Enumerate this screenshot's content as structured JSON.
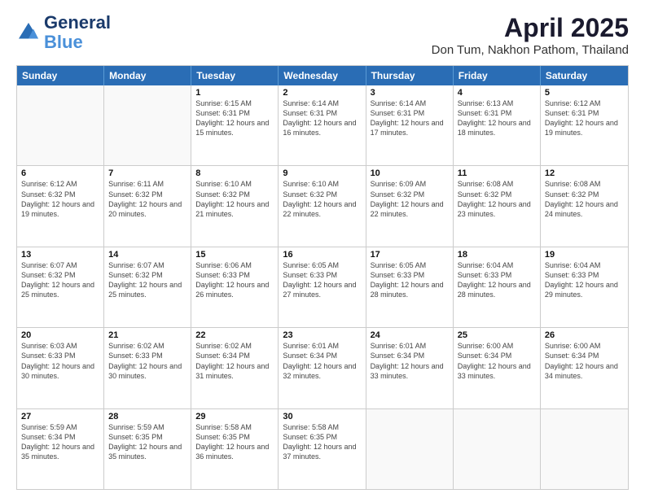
{
  "header": {
    "logo_line1": "General",
    "logo_line2": "Blue",
    "main_title": "April 2025",
    "sub_title": "Don Tum, Nakhon Pathom, Thailand"
  },
  "calendar": {
    "days": [
      "Sunday",
      "Monday",
      "Tuesday",
      "Wednesday",
      "Thursday",
      "Friday",
      "Saturday"
    ],
    "rows": [
      [
        {
          "day": "",
          "info": ""
        },
        {
          "day": "",
          "info": ""
        },
        {
          "day": "1",
          "info": "Sunrise: 6:15 AM\nSunset: 6:31 PM\nDaylight: 12 hours and 15 minutes."
        },
        {
          "day": "2",
          "info": "Sunrise: 6:14 AM\nSunset: 6:31 PM\nDaylight: 12 hours and 16 minutes."
        },
        {
          "day": "3",
          "info": "Sunrise: 6:14 AM\nSunset: 6:31 PM\nDaylight: 12 hours and 17 minutes."
        },
        {
          "day": "4",
          "info": "Sunrise: 6:13 AM\nSunset: 6:31 PM\nDaylight: 12 hours and 18 minutes."
        },
        {
          "day": "5",
          "info": "Sunrise: 6:12 AM\nSunset: 6:31 PM\nDaylight: 12 hours and 19 minutes."
        }
      ],
      [
        {
          "day": "6",
          "info": "Sunrise: 6:12 AM\nSunset: 6:32 PM\nDaylight: 12 hours and 19 minutes."
        },
        {
          "day": "7",
          "info": "Sunrise: 6:11 AM\nSunset: 6:32 PM\nDaylight: 12 hours and 20 minutes."
        },
        {
          "day": "8",
          "info": "Sunrise: 6:10 AM\nSunset: 6:32 PM\nDaylight: 12 hours and 21 minutes."
        },
        {
          "day": "9",
          "info": "Sunrise: 6:10 AM\nSunset: 6:32 PM\nDaylight: 12 hours and 22 minutes."
        },
        {
          "day": "10",
          "info": "Sunrise: 6:09 AM\nSunset: 6:32 PM\nDaylight: 12 hours and 22 minutes."
        },
        {
          "day": "11",
          "info": "Sunrise: 6:08 AM\nSunset: 6:32 PM\nDaylight: 12 hours and 23 minutes."
        },
        {
          "day": "12",
          "info": "Sunrise: 6:08 AM\nSunset: 6:32 PM\nDaylight: 12 hours and 24 minutes."
        }
      ],
      [
        {
          "day": "13",
          "info": "Sunrise: 6:07 AM\nSunset: 6:32 PM\nDaylight: 12 hours and 25 minutes."
        },
        {
          "day": "14",
          "info": "Sunrise: 6:07 AM\nSunset: 6:32 PM\nDaylight: 12 hours and 25 minutes."
        },
        {
          "day": "15",
          "info": "Sunrise: 6:06 AM\nSunset: 6:33 PM\nDaylight: 12 hours and 26 minutes."
        },
        {
          "day": "16",
          "info": "Sunrise: 6:05 AM\nSunset: 6:33 PM\nDaylight: 12 hours and 27 minutes."
        },
        {
          "day": "17",
          "info": "Sunrise: 6:05 AM\nSunset: 6:33 PM\nDaylight: 12 hours and 28 minutes."
        },
        {
          "day": "18",
          "info": "Sunrise: 6:04 AM\nSunset: 6:33 PM\nDaylight: 12 hours and 28 minutes."
        },
        {
          "day": "19",
          "info": "Sunrise: 6:04 AM\nSunset: 6:33 PM\nDaylight: 12 hours and 29 minutes."
        }
      ],
      [
        {
          "day": "20",
          "info": "Sunrise: 6:03 AM\nSunset: 6:33 PM\nDaylight: 12 hours and 30 minutes."
        },
        {
          "day": "21",
          "info": "Sunrise: 6:02 AM\nSunset: 6:33 PM\nDaylight: 12 hours and 30 minutes."
        },
        {
          "day": "22",
          "info": "Sunrise: 6:02 AM\nSunset: 6:34 PM\nDaylight: 12 hours and 31 minutes."
        },
        {
          "day": "23",
          "info": "Sunrise: 6:01 AM\nSunset: 6:34 PM\nDaylight: 12 hours and 32 minutes."
        },
        {
          "day": "24",
          "info": "Sunrise: 6:01 AM\nSunset: 6:34 PM\nDaylight: 12 hours and 33 minutes."
        },
        {
          "day": "25",
          "info": "Sunrise: 6:00 AM\nSunset: 6:34 PM\nDaylight: 12 hours and 33 minutes."
        },
        {
          "day": "26",
          "info": "Sunrise: 6:00 AM\nSunset: 6:34 PM\nDaylight: 12 hours and 34 minutes."
        }
      ],
      [
        {
          "day": "27",
          "info": "Sunrise: 5:59 AM\nSunset: 6:34 PM\nDaylight: 12 hours and 35 minutes."
        },
        {
          "day": "28",
          "info": "Sunrise: 5:59 AM\nSunset: 6:35 PM\nDaylight: 12 hours and 35 minutes."
        },
        {
          "day": "29",
          "info": "Sunrise: 5:58 AM\nSunset: 6:35 PM\nDaylight: 12 hours and 36 minutes."
        },
        {
          "day": "30",
          "info": "Sunrise: 5:58 AM\nSunset: 6:35 PM\nDaylight: 12 hours and 37 minutes."
        },
        {
          "day": "",
          "info": ""
        },
        {
          "day": "",
          "info": ""
        },
        {
          "day": "",
          "info": ""
        }
      ]
    ]
  }
}
